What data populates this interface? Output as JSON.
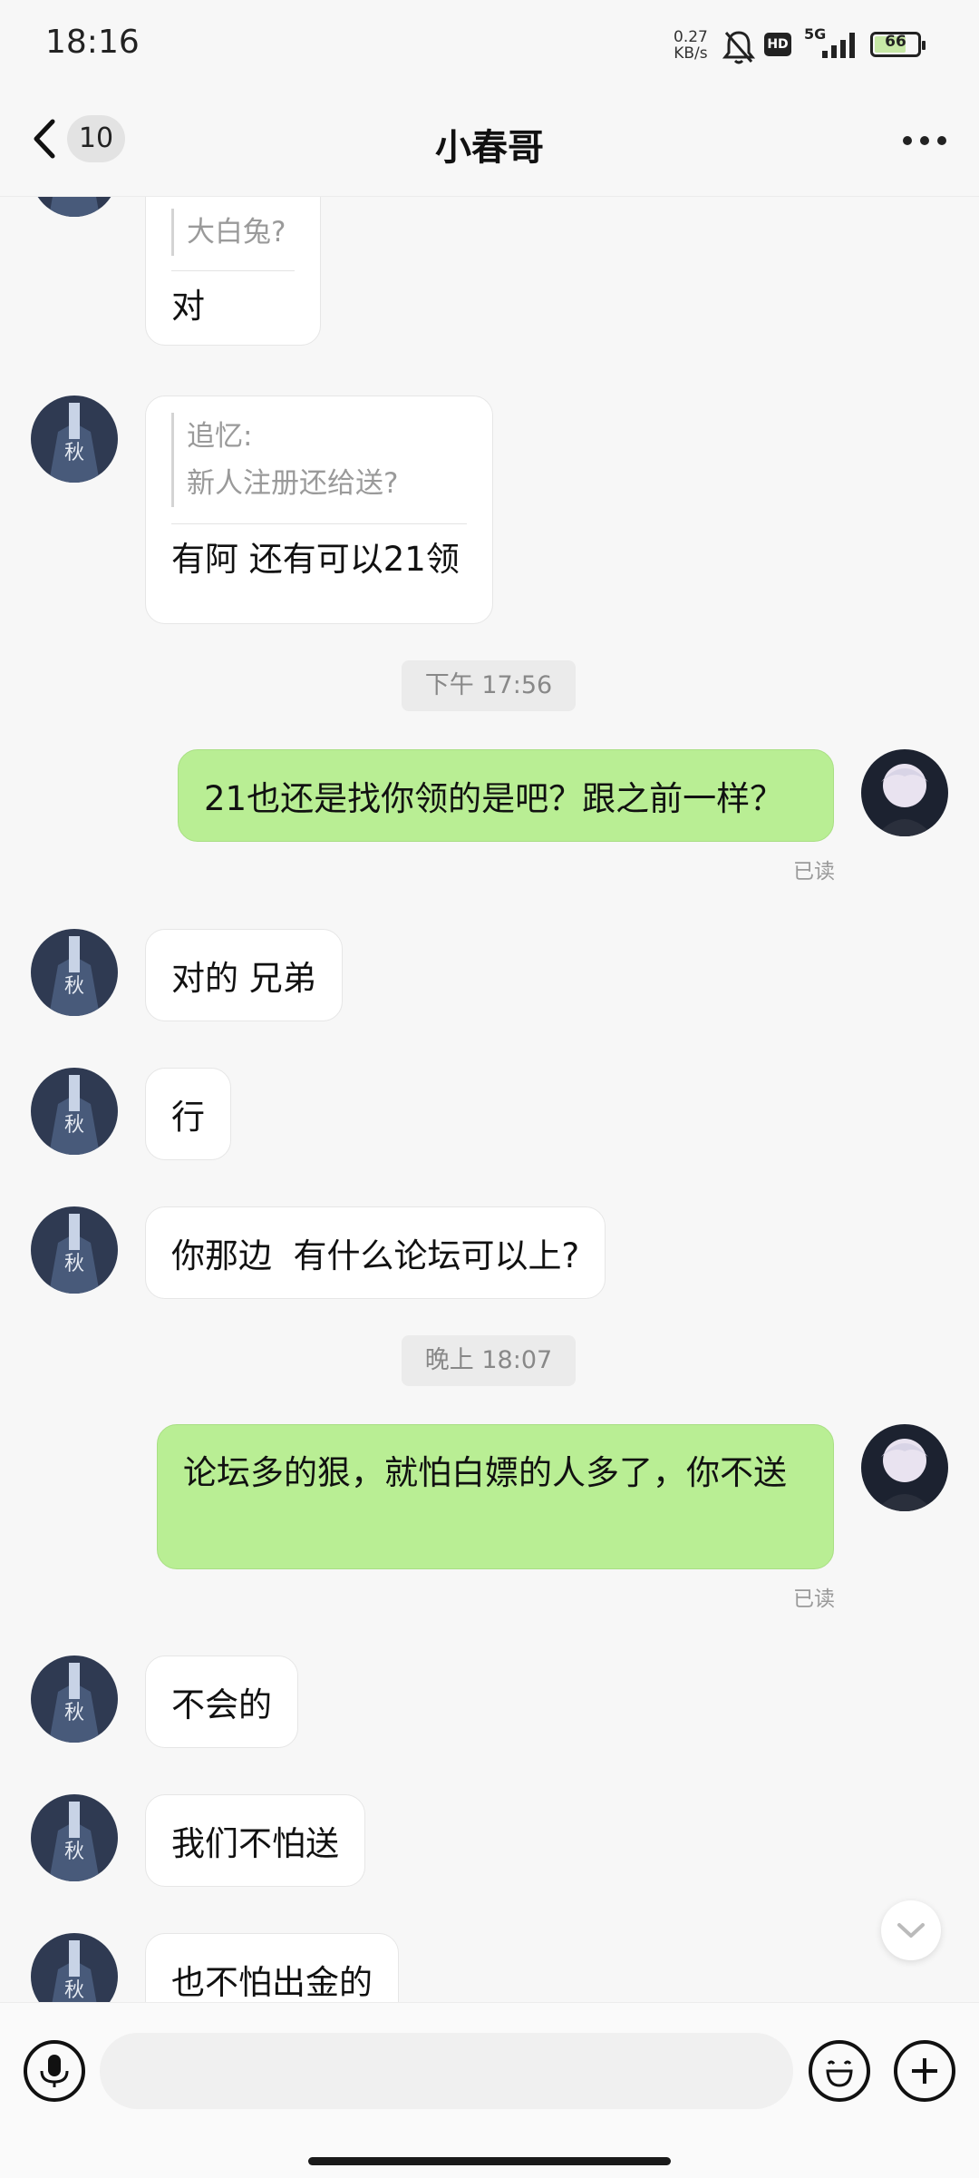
{
  "status_bar": {
    "time": "18:16",
    "net_speed_value": "0.27",
    "net_speed_unit": "KB/s",
    "hd": "HD",
    "signal_label": "5G",
    "battery": "66",
    "icons": [
      "bell-off-icon",
      "hd-icon",
      "signal-5g-icon",
      "battery-icon"
    ]
  },
  "header": {
    "back_count": "10",
    "title": "小春哥",
    "more_icon": "more-dots-icon"
  },
  "messages": [
    {
      "side": "in",
      "quote_text": "大白兔?",
      "text": "对",
      "partially_visible": true
    },
    {
      "side": "in",
      "quote_author": "追忆:",
      "quote_text": "新人注册还给送?",
      "text": "有阿 还有可以21领"
    },
    {
      "type": "timestamp",
      "text": "下午 17:56"
    },
    {
      "side": "out",
      "text": "21也还是找你领的是吧？跟之前一样？",
      "status": "已读"
    },
    {
      "side": "in",
      "text": "对的 兄弟"
    },
    {
      "side": "in",
      "text": "行"
    },
    {
      "side": "in",
      "text": "你那边  有什么论坛可以上?"
    },
    {
      "type": "timestamp",
      "text": "晚上 18:07"
    },
    {
      "side": "out",
      "text": "论坛多的狠，就怕白嫖的人多了，你不送",
      "status": "已读"
    },
    {
      "side": "in",
      "text": "不会的"
    },
    {
      "side": "in",
      "text": "我们不怕送"
    },
    {
      "side": "in",
      "text": "也不怕出金的",
      "partially_visible": true
    }
  ],
  "input_bar": {
    "placeholder": "",
    "icons": [
      "microphone-icon",
      "emoji-icon",
      "plus-icon"
    ]
  },
  "colors": {
    "outgoing_bubble": "#b9ee94",
    "incoming_bubble": "#ffffff",
    "background": "#f7f7f7"
  }
}
